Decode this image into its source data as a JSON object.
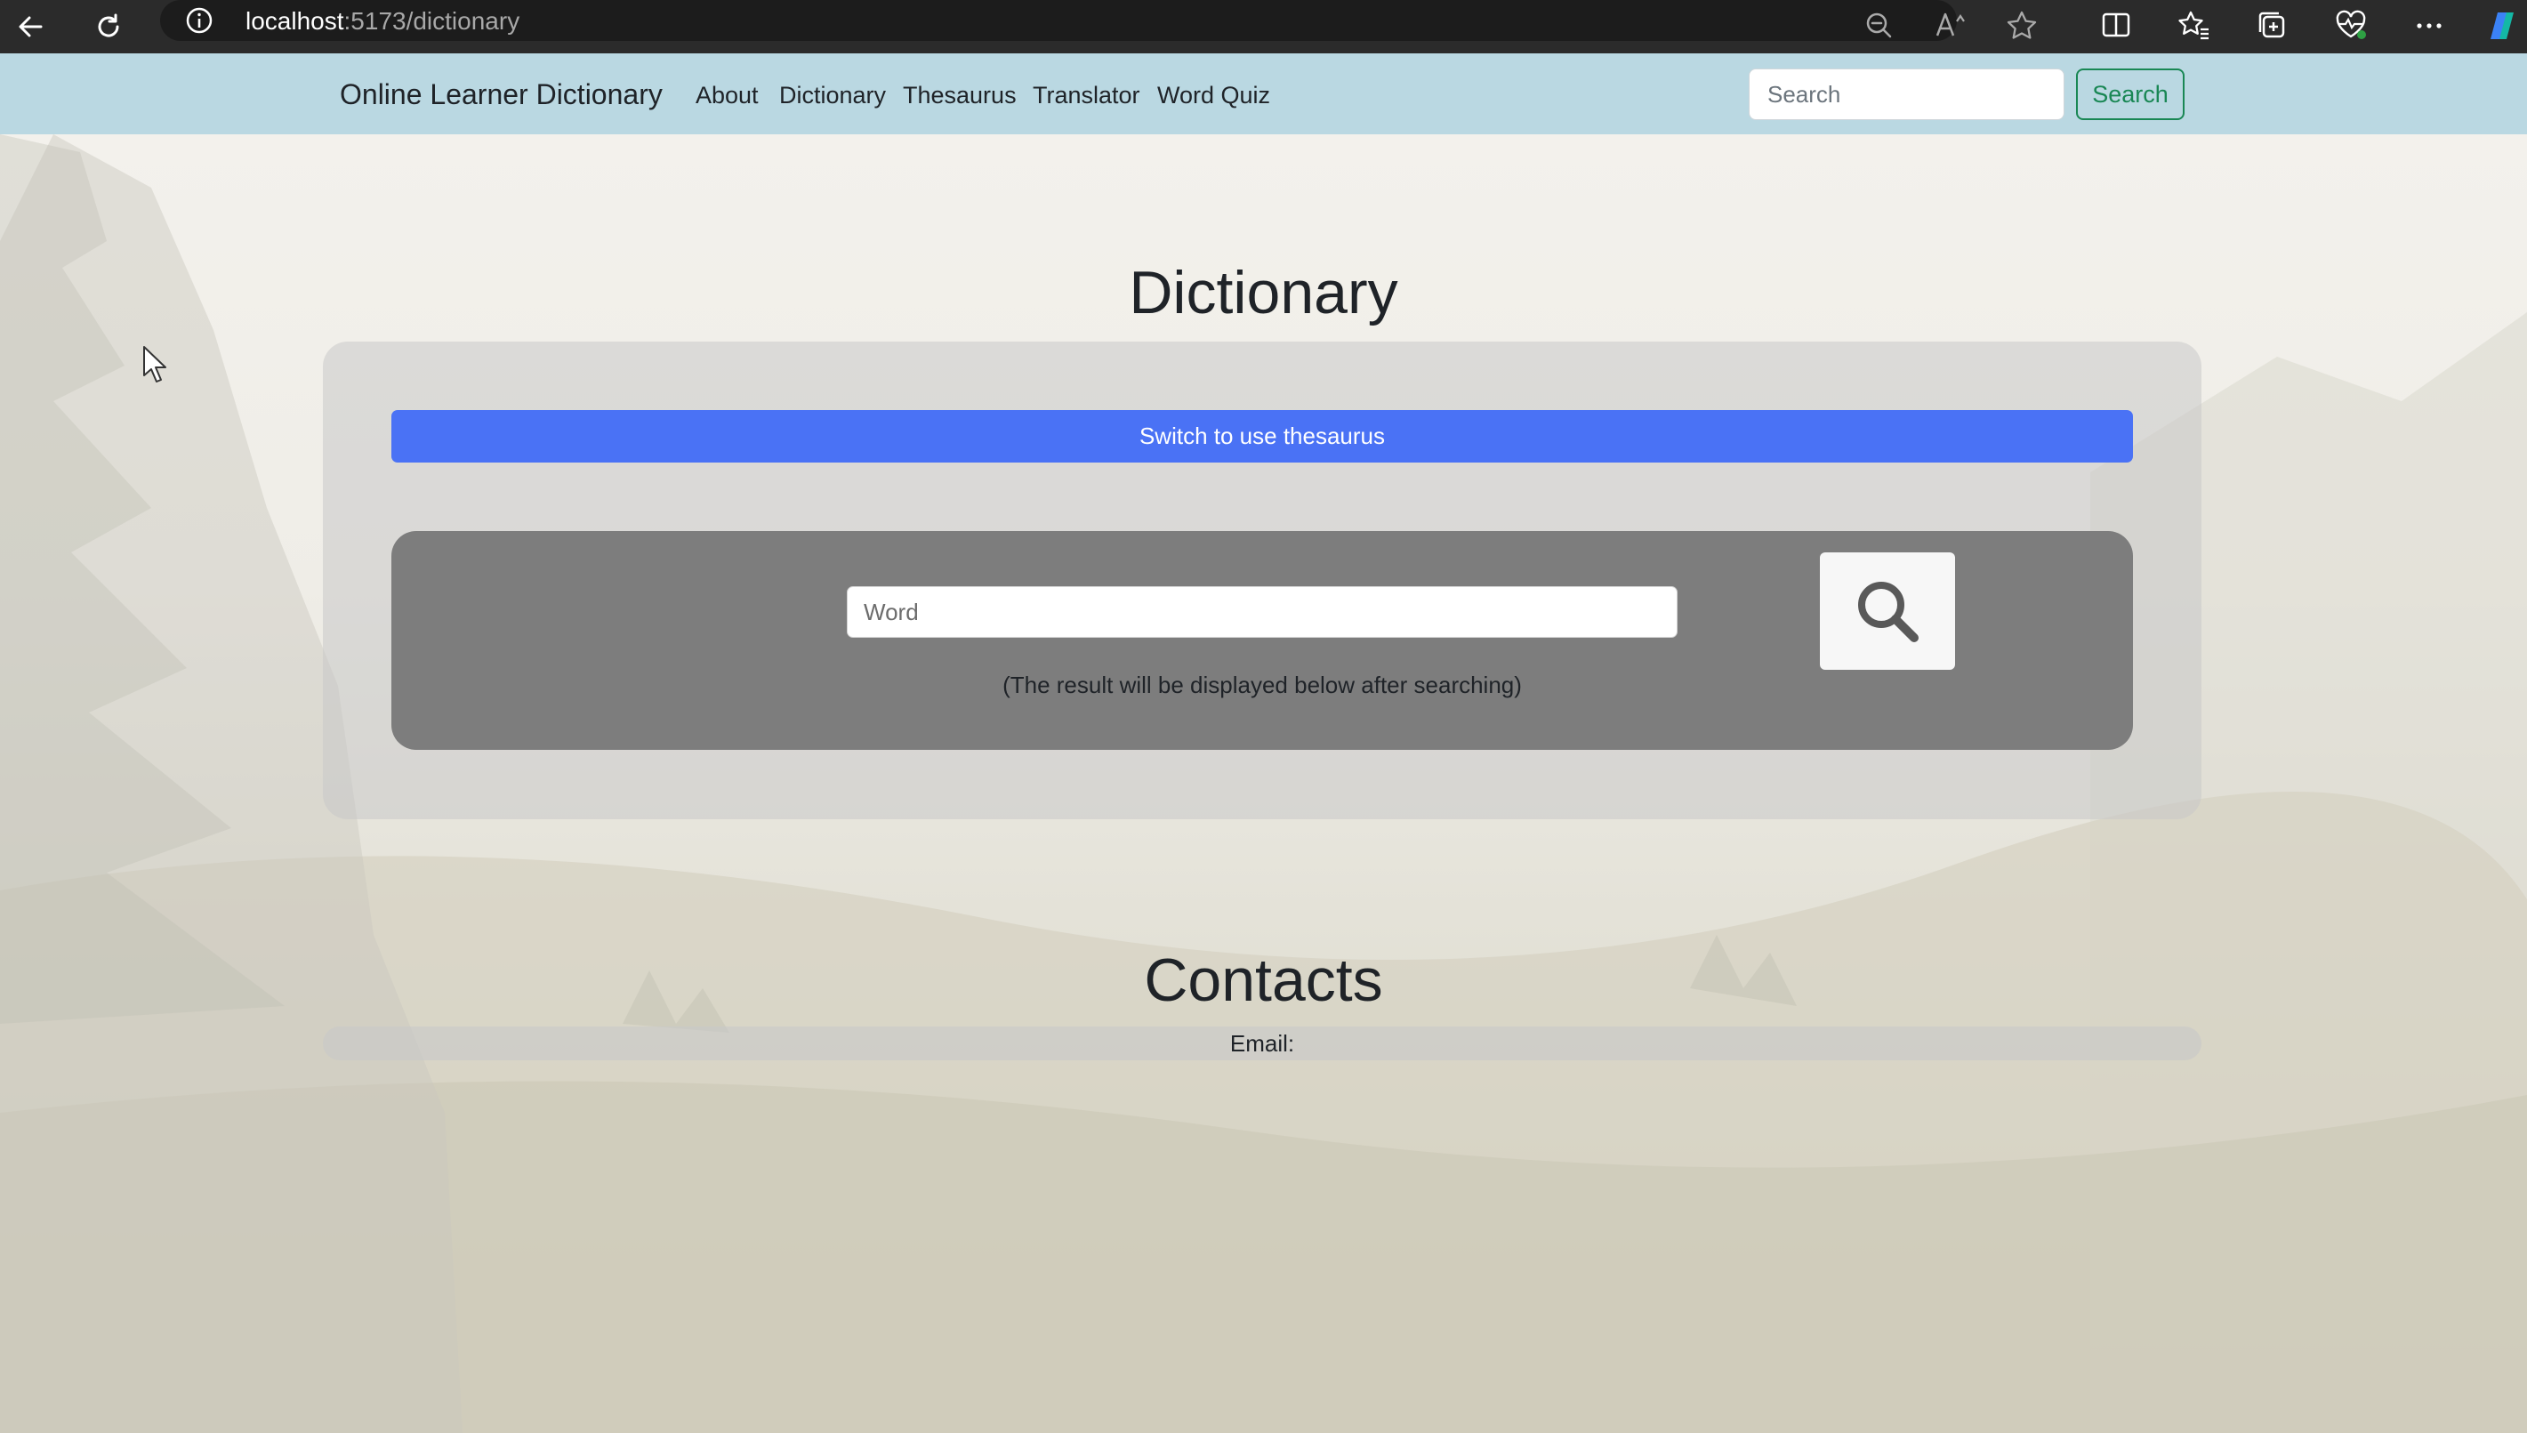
{
  "browser": {
    "url_host": "localhost",
    "url_path": ":5173/dictionary",
    "icons": [
      "back-icon",
      "refresh-icon",
      "info-icon",
      "zoom-out-icon",
      "read-aloud-icon",
      "favorite-star-icon",
      "split-screen-icon",
      "favorites-icon",
      "collections-icon",
      "health-icon",
      "more-icon",
      "copilot-icon"
    ]
  },
  "navbar": {
    "brand": "Online Learner Dictionary",
    "links": [
      "About",
      "Dictionary",
      "Thesaurus",
      "Translator",
      "Word Quiz"
    ],
    "search_placeholder": "Search",
    "search_button": "Search"
  },
  "main": {
    "title": "Dictionary",
    "switch_button": "Switch to use thesaurus",
    "word_placeholder": "Word",
    "hint": "(The result will be displayed below after searching)"
  },
  "contacts": {
    "title": "Contacts",
    "email_label": "Email:"
  },
  "colors": {
    "navbar_bg": "#bad8e2",
    "switch_button": "#4a72f5",
    "search_button_outline": "#198754",
    "search_box_bg": "#7d7d7d"
  }
}
